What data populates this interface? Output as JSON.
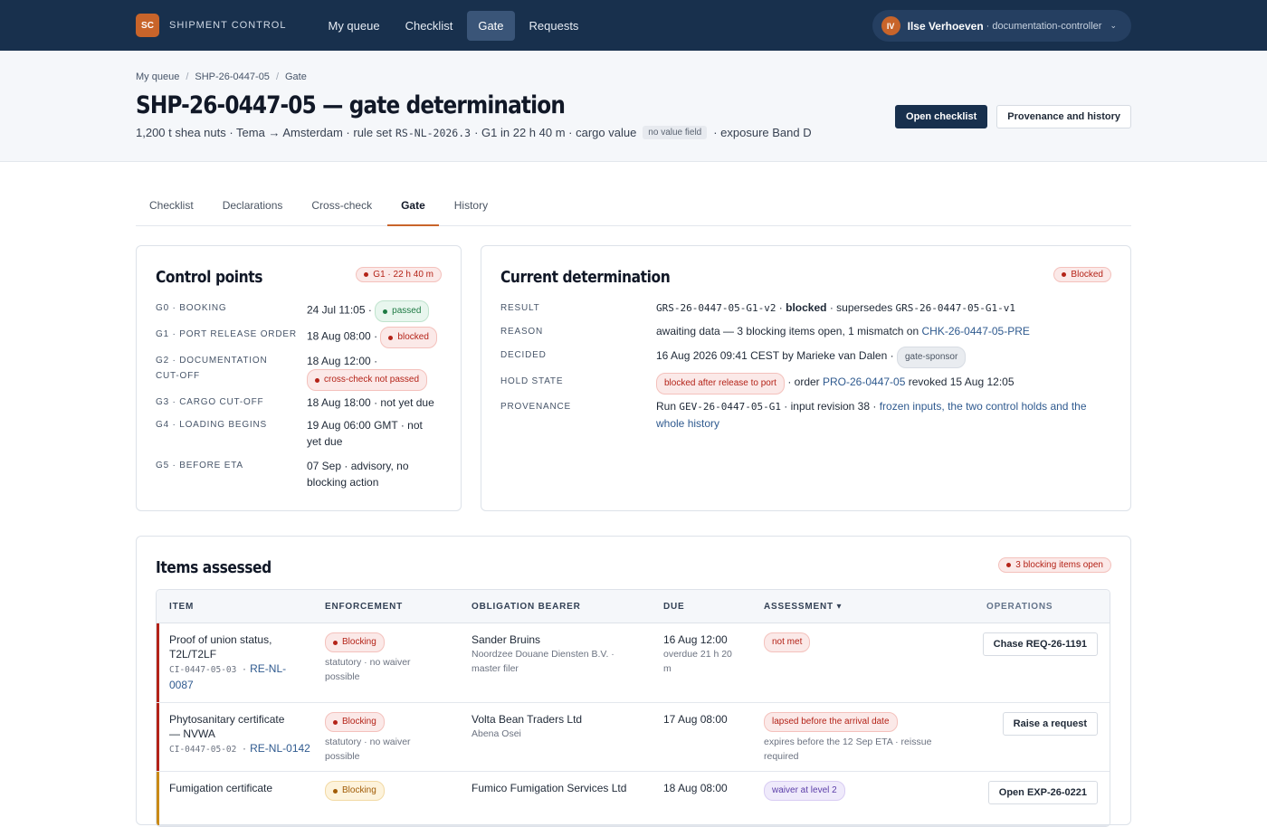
{
  "app": {
    "logo": "SC",
    "name": "SHIPMENT CONTROL"
  },
  "nav": [
    {
      "label": "My queue",
      "active": false
    },
    {
      "label": "Checklist",
      "active": false
    },
    {
      "label": "Gate",
      "active": true
    },
    {
      "label": "Requests",
      "active": false
    }
  ],
  "user": {
    "initials": "IV",
    "name": "Ilse Verhoeven",
    "role": "· documentation-controller"
  },
  "breadcrumbs": [
    "My queue",
    "SHP-26-0447-05",
    "Gate"
  ],
  "header": {
    "title": "SHP-26-0447-05 — gate determination",
    "sub_prefix": "1,200 t shea nuts · Tema → Amsterdam · rule set",
    "rule_set": "RS-NL-2026.3",
    "sub_mid": "· G1 in 22 h 40 m · cargo value",
    "no_value_chip": "no value field",
    "sub_suffix": "· exposure Band D",
    "btn_checklist": "Open checklist",
    "btn_provenance": "Provenance and history"
  },
  "tabs": [
    {
      "label": "Checklist",
      "active": false
    },
    {
      "label": "Declarations",
      "active": false
    },
    {
      "label": "Cross-check",
      "active": false
    },
    {
      "label": "Gate",
      "active": true
    },
    {
      "label": "History",
      "active": false
    }
  ],
  "control_points": {
    "title": "Control points",
    "badge": "G1 · 22 h 40 m",
    "g0": {
      "label": "G0 · BOOKING",
      "value": "24 Jul 11:05 ·",
      "status": "passed"
    },
    "g1": {
      "label": "G1 · PORT RELEASE ORDER",
      "value": "18 Aug 08:00 ·",
      "status": "blocked"
    },
    "g2": {
      "label1": "G2 · DOCUMENTATION",
      "label2": "CUT-OFF",
      "value": "18 Aug 12:00 ·",
      "status": "cross-check not passed"
    },
    "g3": {
      "label": "G3 · CARGO CUT-OFF",
      "value": "18 Aug 18:00 · not yet due"
    },
    "g4": {
      "label": "G4 · LOADING BEGINS",
      "value1": "19 Aug 06:00 GMT · not",
      "value2": "yet due"
    },
    "g5": {
      "label": "G5 · BEFORE ETA",
      "value1": "07 Sep · advisory, no",
      "value2": "blocking action"
    }
  },
  "determination": {
    "title": "Current determination",
    "badge": "Blocked",
    "result": {
      "label": "RESULT",
      "code": "GRS-26-0447-05-G1-v2",
      "strong": "blocked",
      "mid": "· supersedes",
      "old": "GRS-26-0447-05-G1-v1"
    },
    "reason": {
      "label": "REASON",
      "text": "awaiting data — 3 blocking items open, 1 mismatch on",
      "link": "CHK-26-0447-05-PRE"
    },
    "decided": {
      "label": "DECIDED",
      "text": "16 Aug 2026 09:41 CEST by Marieke van Dalen ·",
      "chip": "gate-sponsor"
    },
    "hold": {
      "label": "HOLD STATE",
      "chip": "blocked after release to port",
      "mid": "· order",
      "link": "PRO-26-0447-05",
      "suffix": "revoked 15 Aug 12:05"
    },
    "provenance": {
      "label": "PROVENANCE",
      "prefix": "Run",
      "run": "GEV-26-0447-05-G1",
      "mid": "· input revision 38 ·",
      "link1": "frozen inputs, the two control holds and the",
      "link2": "whole history"
    }
  },
  "items": {
    "title": "Items assessed",
    "badge": "3 blocking items open",
    "columns": {
      "item": "ITEM",
      "enforcement": "ENFORCEMENT",
      "bearer": "OBLIGATION BEARER",
      "due": "DUE",
      "assessment": "ASSESSMENT ▾",
      "operations": "OPERATIONS"
    },
    "rows": [
      {
        "item1": "Proof of union status,",
        "item2": "T2L/T2LF",
        "code": "CI-0447-05-03 ·",
        "ref1": "RE-NL-",
        "ref2": "0087",
        "enforcement": "Blocking",
        "enf_sub1": "statutory · no waiver",
        "enf_sub2": "possible",
        "bearer": "Sander Bruins",
        "bearer_sub1": "Noordzee Douane Diensten B.V. ·",
        "bearer_sub2": "master filer",
        "due": "16 Aug 12:00",
        "due_sub1": "overdue 21 h 20",
        "due_sub2": "m",
        "assessment": "not met",
        "ass_sub1": "",
        "ass_sub2": "",
        "operation": "Chase REQ-26-1191"
      },
      {
        "item1": "Phytosanitary certificate",
        "item2": "— NVWA",
        "code": "CI-0447-05-02 ·",
        "ref1": "RE-NL-0142",
        "ref2": "",
        "enforcement": "Blocking",
        "enf_sub1": "statutory · no waiver",
        "enf_sub2": "possible",
        "bearer": "Volta Bean Traders Ltd",
        "bearer_sub1": "Abena Osei",
        "bearer_sub2": "",
        "due": "17 Aug 08:00",
        "due_sub1": "",
        "due_sub2": "",
        "assessment": "lapsed before the arrival date",
        "ass_sub1": "expires before the 12 Sep ETA · reissue",
        "ass_sub2": "required",
        "operation": "Raise a request"
      },
      {
        "item1": "Fumigation certificate",
        "item2": "",
        "code": "",
        "ref1": "",
        "ref2": "",
        "enforcement": "Blocking",
        "enf_sub1": "",
        "enf_sub2": "",
        "bearer": "Fumico Fumigation Services Ltd",
        "bearer_sub1": "",
        "bearer_sub2": "",
        "due": "18 Aug 08:00",
        "due_sub1": "",
        "due_sub2": "",
        "assessment": "waiver at level 2",
        "ass_sub1": "",
        "ass_sub2": "",
        "operation": "Open EXP-26-0221"
      }
    ]
  },
  "colors": {
    "navy": "#18304d",
    "accent": "#c8642a",
    "danger": "#b42318",
    "success": "#1e7a44"
  }
}
